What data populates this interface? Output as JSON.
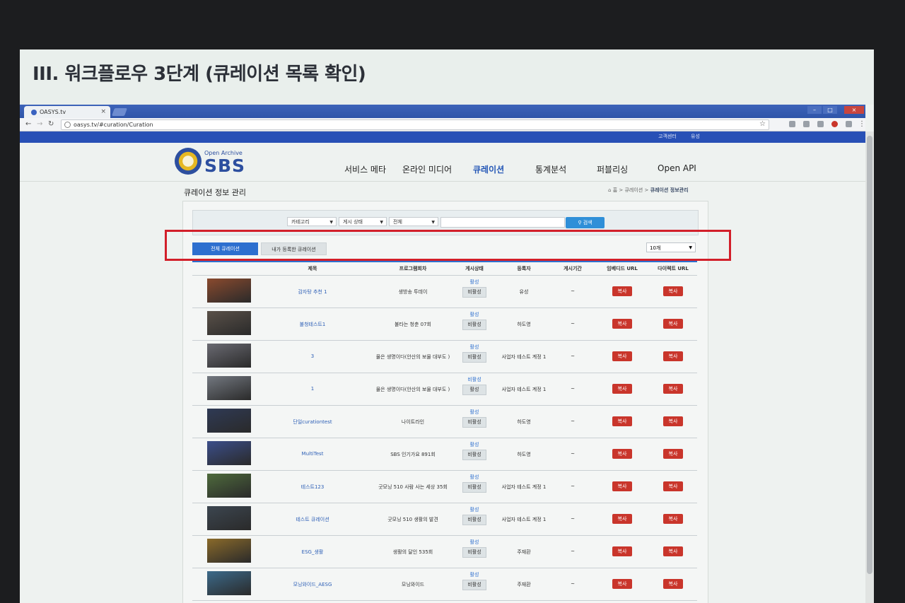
{
  "slide_title": "III. 워크플로우 3단계 (큐레이션 목록 확인)",
  "browser": {
    "tab_title": "OASYS.tv",
    "tab_close": "×",
    "url": "oasys.tv/#curation/Curation",
    "window_controls": {
      "min": "–",
      "max": "□",
      "close": "×"
    }
  },
  "sitebar": {
    "links": [
      "고객센터",
      "유성"
    ]
  },
  "logo": {
    "sub": "Open Archive",
    "main": "SBS"
  },
  "nav": [
    {
      "label": "서비스 메타",
      "active": false
    },
    {
      "label": "온라인 미디어",
      "active": false
    },
    {
      "label": "큐레이션",
      "active": true
    },
    {
      "label": "통계분석",
      "active": false
    },
    {
      "label": "퍼블리싱",
      "active": false
    },
    {
      "label": "Open API",
      "active": false
    }
  ],
  "page": {
    "title": "큐레이션 정보 관리",
    "breadcrumb_home": "홈",
    "breadcrumb_sep": ">",
    "breadcrumb_mid": "큐레이션",
    "breadcrumb_current": "큐레이션 정보관리"
  },
  "search": {
    "category": "카테고리",
    "post_status": "게시 상태",
    "scope": "전체",
    "query": "",
    "button": "검색"
  },
  "tabs": {
    "all": "전체 큐레이션",
    "mine": "내가 등록한 큐레이션"
  },
  "page_size": "10개",
  "columns": [
    "제목",
    "프로그램회차",
    "게시상태",
    "등록자",
    "게시기간",
    "임베디드 URL",
    "다이렉트 URL"
  ],
  "rows": [
    {
      "title": "감자탕 추천 1",
      "program": "생방송 투데이",
      "status1": "활성",
      "status2": "비활성",
      "author": "유성",
      "period": "~",
      "embed": "복사",
      "direct": "복사",
      "thumb": "#8a4a2e"
    },
    {
      "title": "불청테스트1",
      "program": "불타는 청춘 07회",
      "status1": "활성",
      "status2": "비활성",
      "author": "하도영",
      "period": "~",
      "embed": "복사",
      "direct": "복사",
      "thumb": "#5a5149"
    },
    {
      "title": "3",
      "program": "물은 생명이다(안산의 보물 대부도 )",
      "status1": "활성",
      "status2": "비활성",
      "author": "사업자 테스트 계정 1",
      "period": "~",
      "embed": "복사",
      "direct": "복사",
      "thumb": "#6a6a72"
    },
    {
      "title": "1",
      "program": "물은 생명이다(안산의 보물 대부도 )",
      "status1": "비활성",
      "status2": "활성",
      "author": "사업자 테스트 계정 1",
      "period": "~",
      "embed": "복사",
      "direct": "복사",
      "thumb": "#737880"
    },
    {
      "title": "단일curationtest",
      "program": "나이트라인",
      "status1": "활성",
      "status2": "비활성",
      "author": "하도영",
      "period": "~",
      "embed": "복사",
      "direct": "복사",
      "thumb": "#2f3a55"
    },
    {
      "title": "MultiTest",
      "program": "SBS 인기가요 891회",
      "status1": "활성",
      "status2": "비활성",
      "author": "하도영",
      "period": "~",
      "embed": "복사",
      "direct": "복사",
      "thumb": "#3b4e8a"
    },
    {
      "title": "테스트123",
      "program": "굿모닝 510 사람 사는 세상 35회",
      "status1": "활성",
      "status2": "비활성",
      "author": "사업자 테스트 계정 1",
      "period": "~",
      "embed": "복사",
      "direct": "복사",
      "thumb": "#4e6a3c"
    },
    {
      "title": "테스트 큐레이션",
      "program": "굿모닝 510 생활의 발견",
      "status1": "활성",
      "status2": "비활성",
      "author": "사업자 테스트 계정 1",
      "period": "~",
      "embed": "복사",
      "direct": "복사",
      "thumb": "#3c4650"
    },
    {
      "title": "ESG_생활",
      "program": "생활의 달인 535회",
      "status1": "활성",
      "status2": "비활성",
      "author": "주재환",
      "period": "~",
      "embed": "복사",
      "direct": "복사",
      "thumb": "#8a6a2a"
    },
    {
      "title": "모닝와이드_AESG",
      "program": "모닝와이드",
      "status1": "활성",
      "status2": "비활성",
      "author": "주재환",
      "period": "~",
      "embed": "복사",
      "direct": "복사",
      "thumb": "#3c6a8a"
    }
  ]
}
